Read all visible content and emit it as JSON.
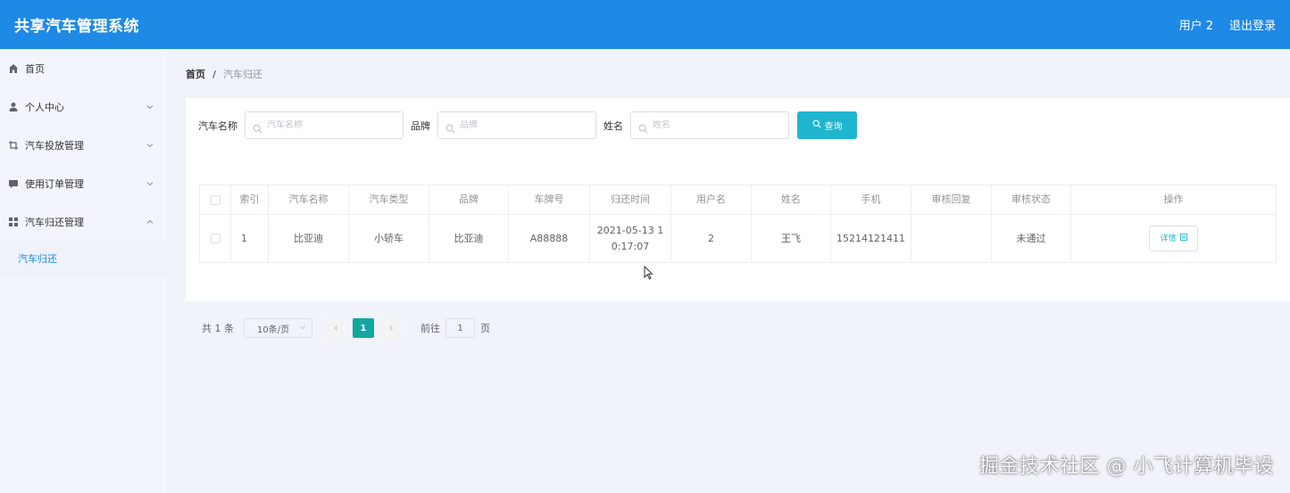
{
  "header": {
    "title": "共享汽车管理系统",
    "user": "用户 2",
    "logout": "退出登录"
  },
  "sidebar": {
    "items": [
      {
        "label": "首页",
        "icon": "home-icon"
      },
      {
        "label": "个人中心",
        "icon": "user-icon"
      },
      {
        "label": "汽车投放管理",
        "icon": "crop-icon"
      },
      {
        "label": "使用订单管理",
        "icon": "message-icon"
      },
      {
        "label": "汽车归还管理",
        "icon": "grid-icon"
      }
    ],
    "submenu": [
      "汽车归还"
    ]
  },
  "breadcrumb": {
    "home": "首页",
    "separator": "/",
    "current": "汽车归还"
  },
  "search": {
    "fields": [
      {
        "label": "汽车名称",
        "placeholder": "汽车名称"
      },
      {
        "label": "品牌",
        "placeholder": "品牌"
      },
      {
        "label": "姓名",
        "placeholder": "姓名"
      }
    ],
    "button": "查询"
  },
  "table": {
    "columns": [
      "索引",
      "汽车名称",
      "汽车类型",
      "品牌",
      "车牌号",
      "归还时间",
      "用户名",
      "姓名",
      "手机",
      "审核回复",
      "审核状态",
      "操作"
    ],
    "rows": [
      {
        "index": "1",
        "car_name": "比亚迪",
        "car_type": "小轿车",
        "brand": "比亚迪",
        "plate": "A88888",
        "return_time_1": "2021-05-13 1",
        "return_time_2": "0:17:07",
        "username": "2",
        "name": "王飞",
        "phone": "15214121411",
        "reply": "",
        "status": "未通过",
        "action": "详情"
      }
    ]
  },
  "pagination": {
    "total": "共 1 条",
    "page_size": "10条/页",
    "current_page": "1",
    "goto_label": "前往",
    "goto_value": "1",
    "page_suffix": "页"
  },
  "watermark": "掘金技术社区 @ 小飞计算机毕设",
  "colors": {
    "header": "#1f89e6",
    "query_button": "#1fb5cf",
    "active_page": "#13a89e"
  }
}
